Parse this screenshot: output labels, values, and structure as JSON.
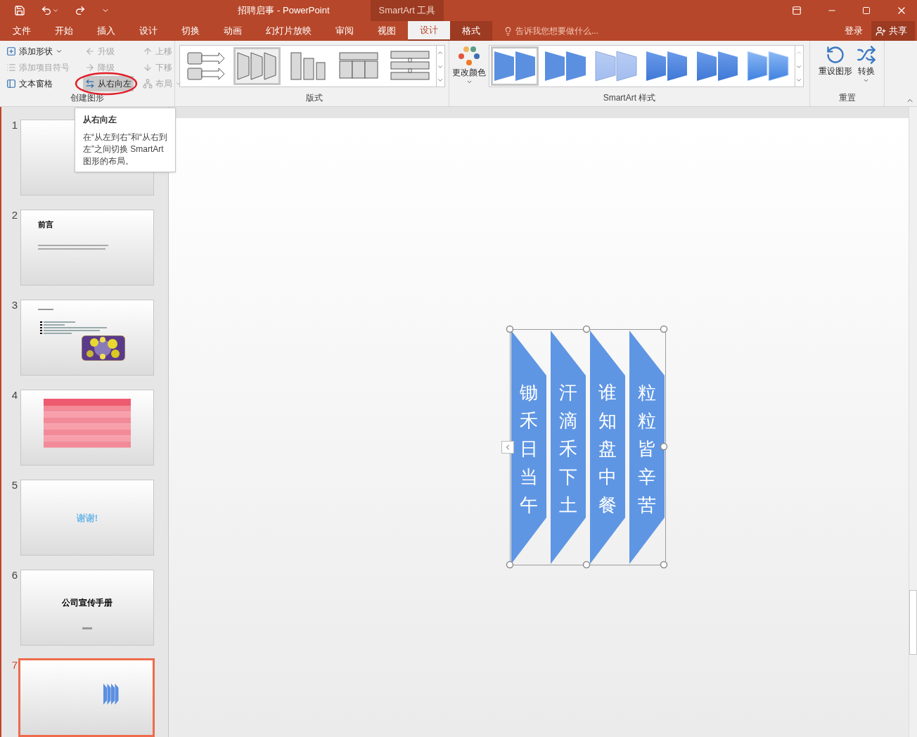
{
  "title_bar": {
    "title": "招聘启事 - PowerPoint",
    "context_label": "SmartArt 工具"
  },
  "tabs": [
    {
      "label": "文件",
      "selected": false,
      "kind": "normal"
    },
    {
      "label": "开始",
      "selected": false,
      "kind": "normal"
    },
    {
      "label": "插入",
      "selected": false,
      "kind": "normal"
    },
    {
      "label": "设计",
      "selected": false,
      "kind": "normal"
    },
    {
      "label": "切换",
      "selected": false,
      "kind": "normal"
    },
    {
      "label": "动画",
      "selected": false,
      "kind": "normal"
    },
    {
      "label": "幻灯片放映",
      "selected": false,
      "kind": "normal"
    },
    {
      "label": "审阅",
      "selected": false,
      "kind": "normal"
    },
    {
      "label": "视图",
      "selected": false,
      "kind": "normal"
    },
    {
      "label": "设计",
      "selected": true,
      "kind": "context"
    },
    {
      "label": "格式",
      "selected": false,
      "kind": "context"
    }
  ],
  "tell_me": {
    "placeholder": "告诉我您想要做什么..."
  },
  "account": {
    "sign_in": "登录",
    "share": "共享"
  },
  "create_graphic": {
    "label": "创建图形",
    "columns": [
      [
        {
          "label": "添加形状",
          "kind": "add-shape",
          "disabled": false,
          "dropdown": true,
          "highlighted": false,
          "circled": false
        },
        {
          "label": "添加项目符号",
          "kind": "add-bullet",
          "disabled": true,
          "dropdown": false,
          "highlighted": false,
          "circled": false
        },
        {
          "label": "文本窗格",
          "kind": "text-pane",
          "disabled": false,
          "dropdown": false,
          "highlighted": false,
          "circled": false
        }
      ],
      [
        {
          "label": "升级",
          "kind": "promote",
          "disabled": true,
          "dropdown": false,
          "highlighted": false,
          "circled": false
        },
        {
          "label": "降级",
          "kind": "demote",
          "disabled": true,
          "dropdown": false,
          "highlighted": false,
          "circled": false
        },
        {
          "label": "从右向左",
          "kind": "right-to-left",
          "disabled": false,
          "dropdown": false,
          "highlighted": true,
          "circled": true
        }
      ],
      [
        {
          "label": "上移",
          "kind": "move-up",
          "disabled": true,
          "dropdown": false,
          "highlighted": false,
          "circled": false
        },
        {
          "label": "下移",
          "kind": "move-down",
          "disabled": true,
          "dropdown": false,
          "highlighted": false,
          "circled": false
        },
        {
          "label": "布局",
          "kind": "layout",
          "disabled": true,
          "dropdown": true,
          "highlighted": false,
          "circled": false
        }
      ]
    ]
  },
  "layouts": {
    "label": "版式",
    "items": [
      {
        "kind": "arrow-process",
        "selected": false
      },
      {
        "kind": "trapezoid-list",
        "selected": true
      },
      {
        "kind": "bar-list",
        "selected": false
      },
      {
        "kind": "table-list",
        "selected": false
      },
      {
        "kind": "stacked-flow",
        "selected": false
      }
    ]
  },
  "styles": {
    "label": "SmartArt 样式",
    "change_colors": "更改颜色",
    "items": [
      {
        "kind": "flat",
        "selected": true
      },
      {
        "kind": "moderate",
        "selected": false
      },
      {
        "kind": "light",
        "selected": false
      },
      {
        "kind": "gradient",
        "selected": false
      },
      {
        "kind": "shadow",
        "selected": false
      },
      {
        "kind": "bevel",
        "selected": false
      }
    ]
  },
  "reset": {
    "label": "重置",
    "reset_graphic": "重设图形",
    "convert": "转换"
  },
  "tooltip": {
    "title": "从右向左",
    "body": "在“从左到右”和“从右到左”之间切换 SmartArt 图形的布局。"
  },
  "slides": [
    {
      "number": "1",
      "selected": false,
      "kind": "title"
    },
    {
      "number": "2",
      "selected": false,
      "kind": "text",
      "title": "前言"
    },
    {
      "number": "3",
      "selected": false,
      "kind": "bullets-photo"
    },
    {
      "number": "4",
      "selected": false,
      "kind": "table"
    },
    {
      "number": "5",
      "selected": false,
      "kind": "thanks",
      "title": "谢谢!"
    },
    {
      "number": "6",
      "selected": false,
      "kind": "cover",
      "title": "公司宣传手册"
    },
    {
      "number": "7",
      "selected": true,
      "kind": "smartart"
    }
  ],
  "smartart": {
    "selected": true,
    "columns": [
      {
        "text": "锄禾日当午"
      },
      {
        "text": "汗滴禾下土"
      },
      {
        "text": "谁知盘中餐"
      },
      {
        "text": "粒粒皆辛苦"
      }
    ]
  }
}
